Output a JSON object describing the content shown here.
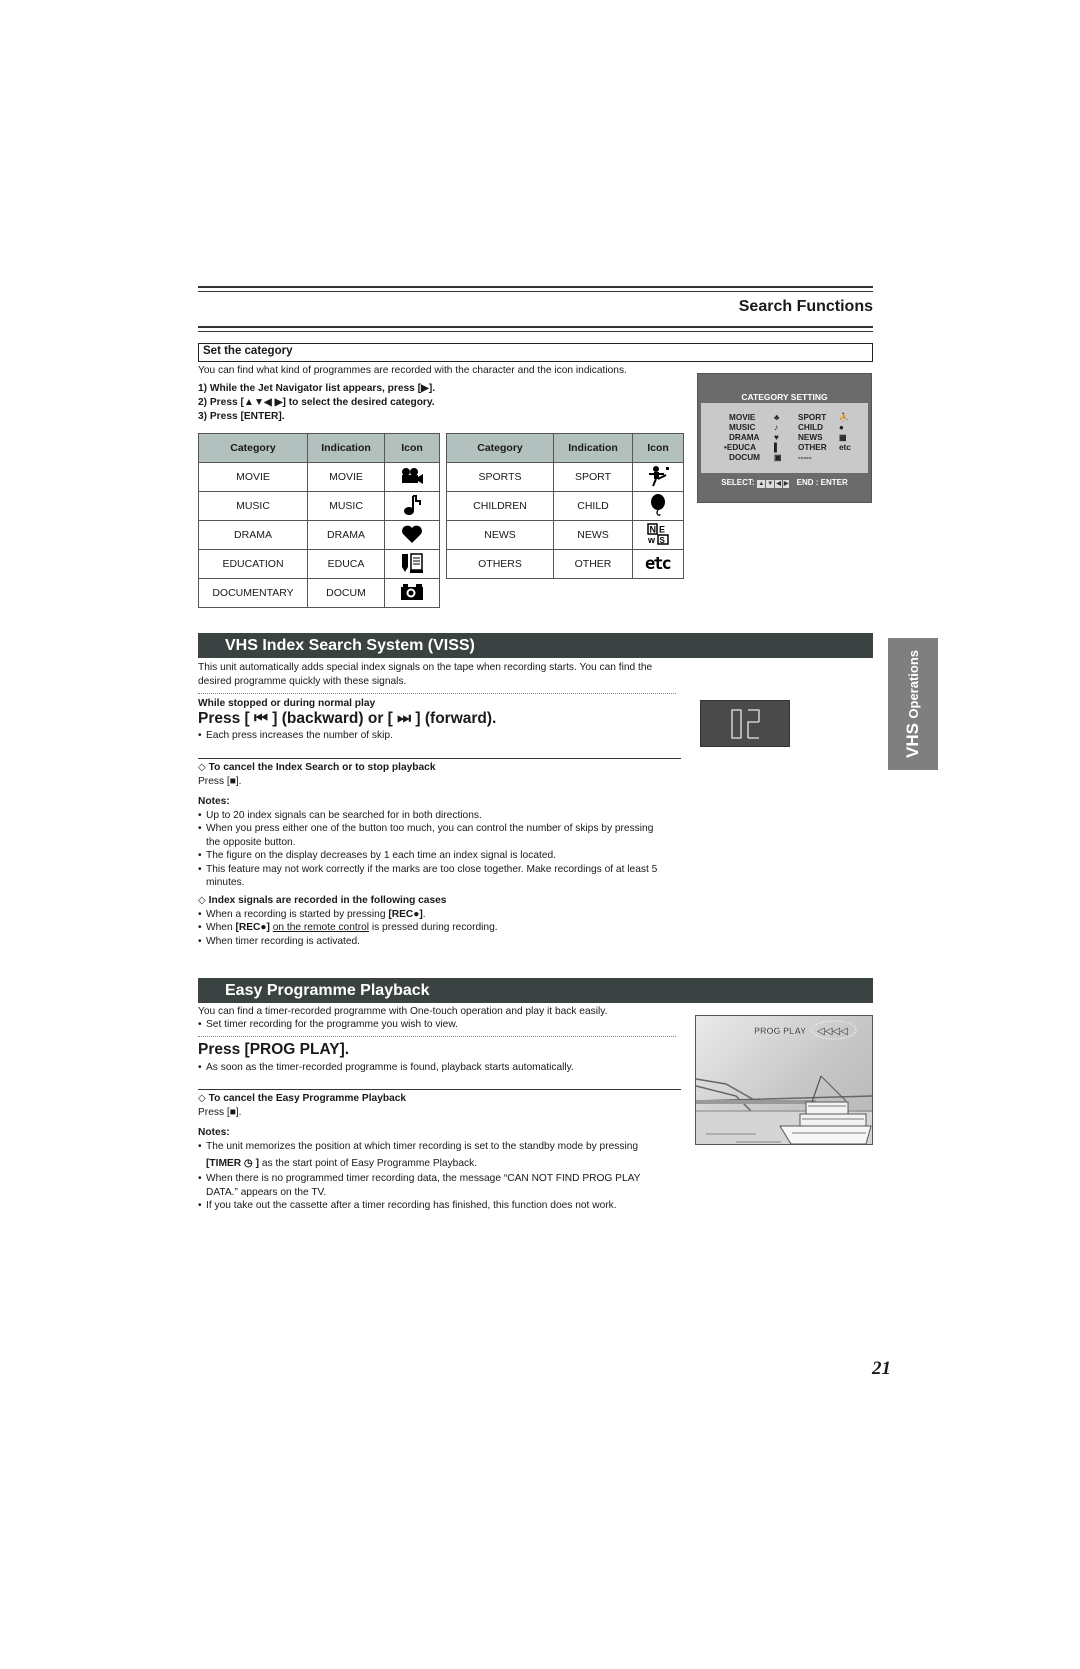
{
  "header": {
    "title": "Search Functions"
  },
  "set_category": {
    "heading": "Set the category",
    "intro": "You can find what kind of programmes are recorded with the character and the icon indications.",
    "steps": [
      "1)   While the Jet Navigator list appears, press [▶].",
      "2)   Press [▲▼◀ ▶] to select the desired category.",
      "3)   Press [ENTER]."
    ],
    "table_headers": [
      "Category",
      "Indication",
      "Icon"
    ],
    "table_left": [
      {
        "category": "MOVIE",
        "indication": "MOVIE",
        "icon": "movie-camera-icon",
        "glyph": "🎥"
      },
      {
        "category": "MUSIC",
        "indication": "MUSIC",
        "icon": "music-note-icon",
        "glyph": "♪"
      },
      {
        "category": "DRAMA",
        "indication": "DRAMA",
        "icon": "heart-icon",
        "glyph": "♥"
      },
      {
        "category": "EDUCATION",
        "indication": "EDUCA",
        "icon": "pencil-book-icon",
        "glyph": "✎≡"
      },
      {
        "category": "DOCUMENTARY",
        "indication": "DOCUM",
        "icon": "camera-icon",
        "glyph": "▣"
      }
    ],
    "table_right": [
      {
        "category": "SPORTS",
        "indication": "SPORT",
        "icon": "kicking-player-icon",
        "glyph": "⛹"
      },
      {
        "category": "CHILDREN",
        "indication": "CHILD",
        "icon": "balloon-icon",
        "glyph": "●"
      },
      {
        "category": "NEWS",
        "indication": "NEWS",
        "icon": "news-icon",
        "glyph": "NE\nWS"
      },
      {
        "category": "OTHERS",
        "indication": "OTHER",
        "icon": "etc-icon",
        "glyph": "ETC"
      }
    ],
    "osd": {
      "title": "CATEGORY SETTING",
      "left": [
        "MOVIE",
        "MUSIC",
        "DRAMA",
        "•EDUCA",
        "DOCUM"
      ],
      "left_icons": [
        "♣",
        "♪",
        "♥",
        "▌",
        "▣"
      ],
      "right": [
        "SPORT",
        "CHILD",
        "NEWS",
        "OTHER",
        "-----"
      ],
      "right_icons": [
        "⛹",
        "●",
        "▦",
        "etc",
        ""
      ],
      "select_label": "SELECT:",
      "select_keys": [
        "▲",
        "▼",
        "◀",
        "▶"
      ],
      "end_label": "END : ENTER"
    }
  },
  "viss": {
    "title": "VHS Index Search System (VISS)",
    "intro_1": "This unit automatically adds special index signals on the tape when recording starts. You can find the",
    "intro_2": "desired programme quickly with these signals.",
    "condition": "While stopped or during normal play",
    "press": "Press [ ⏮ ] (backward) or [ ⏭ ] (forward).",
    "press_note": "Each press increases the number of skip.",
    "display_value": "02",
    "cancel_heading": "To cancel the Index Search or to stop playback",
    "cancel_text": "Press [■].",
    "notes_heading": "Notes:",
    "notes": [
      "Up to 20 index signals can be searched for in both directions.",
      "When you press either one of the button too much, you can control the number of skips by pressing",
      "the opposite button.",
      "The figure on the display decreases by 1 each time an index signal is located.",
      "This feature may not work correctly if the marks are too close together. Make recordings of at least 5",
      "minutes."
    ],
    "index_heading": "Index signals are recorded in the following cases",
    "index_cases": [
      "When a recording is started by pressing [REC●].",
      "When [REC●] on the remote control is pressed during recording.",
      "When timer recording is activated."
    ],
    "index_case_2_parts": {
      "pre": "When ",
      "key": "[REC●]",
      "underlined": "on the remote control",
      "post": " is pressed during recording."
    },
    "index_case_1_parts": {
      "pre": "When a recording is started by pressing ",
      "key": "[REC●]",
      "post": "."
    }
  },
  "side_tab": {
    "big": "VHS",
    "small": "Operations"
  },
  "easy": {
    "title": "Easy Programme Playback",
    "intro": "You can find a timer-recorded programme with One-touch operation and play it back easily.",
    "intro_bullet": "Set timer recording for the programme you wish to view.",
    "press": "Press [PROG PLAY].",
    "press_note": "As soon as the timer-recorded programme is found, playback starts automatically.",
    "cancel_heading": "To cancel the Easy Programme Playback",
    "cancel_text": "Press [■].",
    "notes_heading": "Notes:",
    "note_1a": "The unit memorizes the position at which timer recording is set to the standby mode by pressing",
    "note_1b_key": "[TIMER ◷ ]",
    "note_1b_rest": " as the start point of Easy Programme Playback.",
    "note_2a": "When there is no programmed timer recording data, the message “CAN NOT FIND PROG PLAY",
    "note_2b": "DATA.” appears on the TV.",
    "note_3": "If you take out the cassette after a timer recording has finished, this function does not work.",
    "tv_label": "PROG PLAY",
    "tv_indicator": "◁◁◁◁"
  },
  "page_number": "21"
}
